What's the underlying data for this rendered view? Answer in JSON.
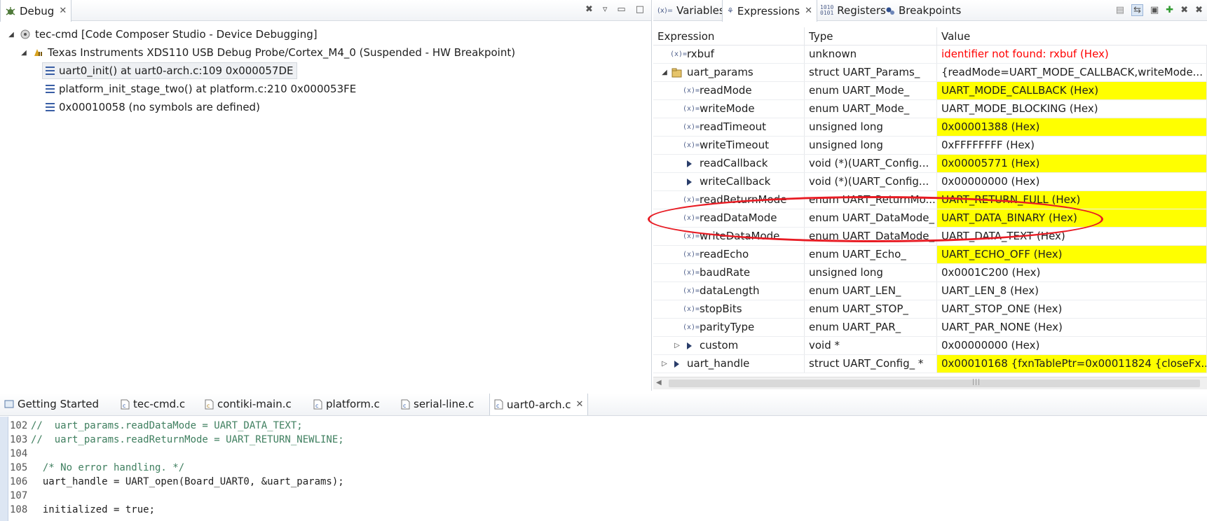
{
  "debug": {
    "tab_label": "Debug",
    "tree": [
      {
        "label": "tec-cmd [Code Composer Studio - Device Debugging]"
      },
      {
        "label": "Texas Instruments XDS110 USB Debug Probe/Cortex_M4_0 (Suspended - HW Breakpoint)"
      },
      {
        "label": "uart0_init() at uart0-arch.c:109 0x000057DE"
      },
      {
        "label": "platform_init_stage_two() at platform.c:210 0x000053FE"
      },
      {
        "label": "0x00010058  (no symbols are defined)"
      }
    ]
  },
  "expressions": {
    "tabs": [
      "Variables",
      "Expressions",
      "Registers",
      "Breakpoints"
    ],
    "columns": [
      "Expression",
      "Type",
      "Value"
    ],
    "rows": [
      {
        "name": "rxbuf",
        "type": "unknown",
        "value": "identifier not found: rxbuf (Hex)"
      },
      {
        "name": "uart_params",
        "type": "struct UART_Params_",
        "value": "{readMode=UART_MODE_CALLBACK,writeMode..."
      },
      {
        "name": "readMode",
        "type": "enum UART_Mode_",
        "value": "UART_MODE_CALLBACK (Hex)"
      },
      {
        "name": "writeMode",
        "type": "enum UART_Mode_",
        "value": "UART_MODE_BLOCKING (Hex)"
      },
      {
        "name": "readTimeout",
        "type": "unsigned long",
        "value": "0x00001388 (Hex)"
      },
      {
        "name": "writeTimeout",
        "type": "unsigned long",
        "value": "0xFFFFFFFF (Hex)"
      },
      {
        "name": "readCallback",
        "type": "void (*)(UART_Config...",
        "value": "0x00005771 (Hex)"
      },
      {
        "name": "writeCallback",
        "type": "void (*)(UART_Config...",
        "value": "0x00000000 (Hex)"
      },
      {
        "name": "readReturnMode",
        "type": "enum UART_ReturnMo...",
        "value": "UART_RETURN_FULL (Hex)"
      },
      {
        "name": "readDataMode",
        "type": "enum UART_DataMode_",
        "value": "UART_DATA_BINARY (Hex)"
      },
      {
        "name": "writeDataMode",
        "type": "enum UART_DataMode_",
        "value": "UART_DATA_TEXT (Hex)"
      },
      {
        "name": "readEcho",
        "type": "enum UART_Echo_",
        "value": "UART_ECHO_OFF (Hex)"
      },
      {
        "name": "baudRate",
        "type": "unsigned long",
        "value": "0x0001C200 (Hex)"
      },
      {
        "name": "dataLength",
        "type": "enum UART_LEN_",
        "value": "UART_LEN_8 (Hex)"
      },
      {
        "name": "stopBits",
        "type": "enum UART_STOP_",
        "value": "UART_STOP_ONE (Hex)"
      },
      {
        "name": "parityType",
        "type": "enum UART_PAR_",
        "value": "UART_PAR_NONE (Hex)"
      },
      {
        "name": "custom",
        "type": "void *",
        "value": "0x00000000 (Hex)"
      },
      {
        "name": "uart_handle",
        "type": "struct UART_Config_ *",
        "value": "0x00010168 {fxnTablePtr=0x00011824 {closeFx..."
      }
    ],
    "colors": {
      "changed_highlight": "#ffff00",
      "error_text": "#ff0000",
      "annotation": "#e81c24"
    }
  },
  "editor": {
    "tabs": [
      "Getting Started",
      "tec-cmd.c",
      "contiki-main.c",
      "platform.c",
      "serial-line.c",
      "uart0-arch.c"
    ],
    "lines": [
      {
        "no": "102",
        "text": "//  uart_params.readDataMode = UART_DATA_TEXT;"
      },
      {
        "no": "103",
        "text": "//  uart_params.readReturnMode = UART_RETURN_NEWLINE;"
      },
      {
        "no": "104",
        "text": ""
      },
      {
        "no": "105",
        "text": "  /* No error handling. */"
      },
      {
        "no": "106",
        "text": "  uart_handle = UART_open(Board_UART0, &uart_params);"
      },
      {
        "no": "107",
        "text": ""
      },
      {
        "no": "108",
        "text": "  initialized = true;"
      }
    ]
  }
}
